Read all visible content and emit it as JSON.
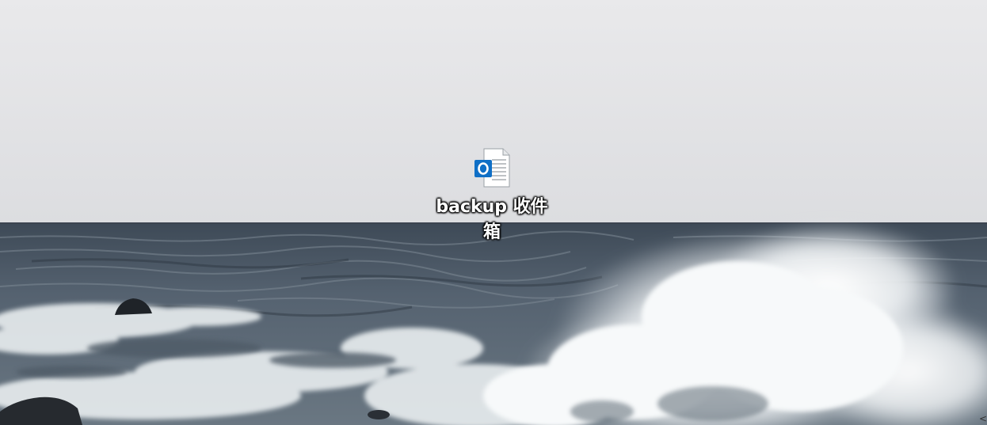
{
  "desktop": {
    "wallpaper": "sea-waves-wallpaper",
    "icons": [
      {
        "label": "backup 收件箱",
        "icon": "outlook-data-file-icon",
        "accent_color": "#0f6fc6"
      }
    ],
    "edge_glyph": "<"
  }
}
